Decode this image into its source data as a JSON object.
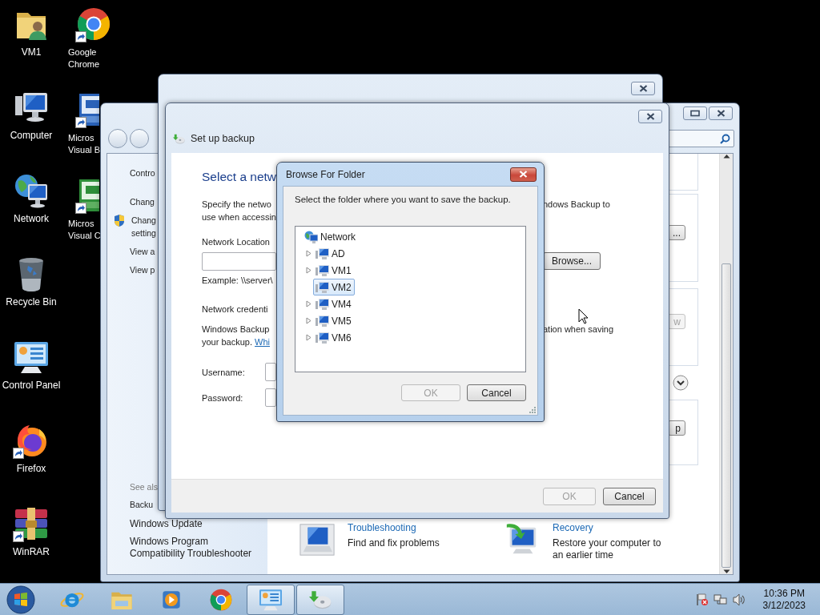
{
  "desktop": {
    "icon_columns": [
      [
        {
          "kind": "user-folder",
          "label": "VM1",
          "shortcut": false
        },
        {
          "kind": "computer",
          "label": "Computer",
          "shortcut": false
        },
        {
          "kind": "network",
          "label": "Network",
          "shortcut": false
        },
        {
          "kind": "recycle-bin",
          "label": "Recycle Bin",
          "shortcut": false
        },
        {
          "kind": "control-panel",
          "label": "Control Panel",
          "shortcut": false
        },
        {
          "kind": "firefox",
          "label": "Firefox",
          "shortcut": true
        },
        {
          "kind": "winrar",
          "label": "WinRAR",
          "shortcut": true
        }
      ],
      [
        {
          "kind": "chrome",
          "label": "Google\nChrome",
          "shortcut": true
        },
        {
          "kind": "vb",
          "label": "Micros\nVisual B",
          "shortcut": true
        },
        {
          "kind": "csharp",
          "label": "Micros\nVisual C",
          "shortcut": true
        }
      ]
    ]
  },
  "control_panel_window": {
    "sidebar": {
      "links": [
        {
          "text": "Contro",
          "shield": false
        },
        {
          "text": "Chang",
          "shield": false
        },
        {
          "text": "Chang\nsetting",
          "shield": true
        },
        {
          "text": "View a",
          "shield": false
        },
        {
          "text": "View p",
          "shield": false
        }
      ],
      "see_also": {
        "heading": "See als",
        "links": [
          "Backu",
          "Windows Update",
          "Windows Program\nCompatibility Troubleshooter"
        ]
      }
    },
    "cards": [
      {
        "kind": "plain"
      },
      {
        "kind": "button",
        "button": "...",
        "disabled": false
      },
      {
        "kind": "button",
        "button": "w",
        "disabled": true
      },
      {
        "kind": "chevron"
      },
      {
        "kind": "button",
        "button": "p",
        "disabled": false
      }
    ],
    "tasks": [
      {
        "kind": "troubleshooting",
        "title": "Troubleshooting",
        "description": "Find and fix problems"
      },
      {
        "kind": "recovery",
        "title": "Recovery",
        "description": "Restore your computer to\nan earlier time"
      }
    ]
  },
  "backup_window": {
    "title": "Set up backup",
    "heading": "Select a netw",
    "intro": {
      "left": "Specify the netwo\nuse when accessin",
      "right": "ndows Backup to"
    },
    "location_label": "Network Location",
    "browse_button": "Browse...",
    "example": "Example: \\\\server\\",
    "credentials_label": "Network credenti",
    "credentials_text": {
      "left": "Windows Backup\nyour backup.",
      "link": "Whi",
      "right": "ation when saving"
    },
    "username_label": "Username:",
    "password_label": "Password:",
    "buttons": [
      {
        "text": "OK",
        "disabled": true
      },
      {
        "text": "Cancel",
        "disabled": false
      }
    ]
  },
  "browse_dialog": {
    "title": "Browse For Folder",
    "prompt": "Select the folder where you want to save the backup.",
    "tree": {
      "label": "Network",
      "selected": false,
      "children": [
        {
          "label": "AD",
          "expandable": true,
          "selected": false
        },
        {
          "label": "VM1",
          "expandable": true,
          "selected": false
        },
        {
          "label": "VM2",
          "expandable": false,
          "selected": true
        },
        {
          "label": "VM4",
          "expandable": true,
          "selected": false
        },
        {
          "label": "VM5",
          "expandable": true,
          "selected": false
        },
        {
          "label": "VM6",
          "expandable": true,
          "selected": false
        }
      ]
    },
    "buttons": [
      {
        "text": "OK",
        "disabled": true
      },
      {
        "text": "Cancel",
        "disabled": false
      }
    ]
  },
  "taskbar": {
    "items": [
      {
        "kind": "ie",
        "active": false
      },
      {
        "kind": "explorer",
        "active": false
      },
      {
        "kind": "media",
        "active": false
      },
      {
        "kind": "chrome",
        "active": false
      },
      {
        "kind": "control-panel",
        "active": true
      },
      {
        "kind": "backup",
        "active": true
      }
    ],
    "tray_icons": [
      {
        "kind": "action-center"
      },
      {
        "kind": "network"
      },
      {
        "kind": "volume"
      }
    ],
    "time": "10:36 PM",
    "date": "3/12/2023"
  }
}
